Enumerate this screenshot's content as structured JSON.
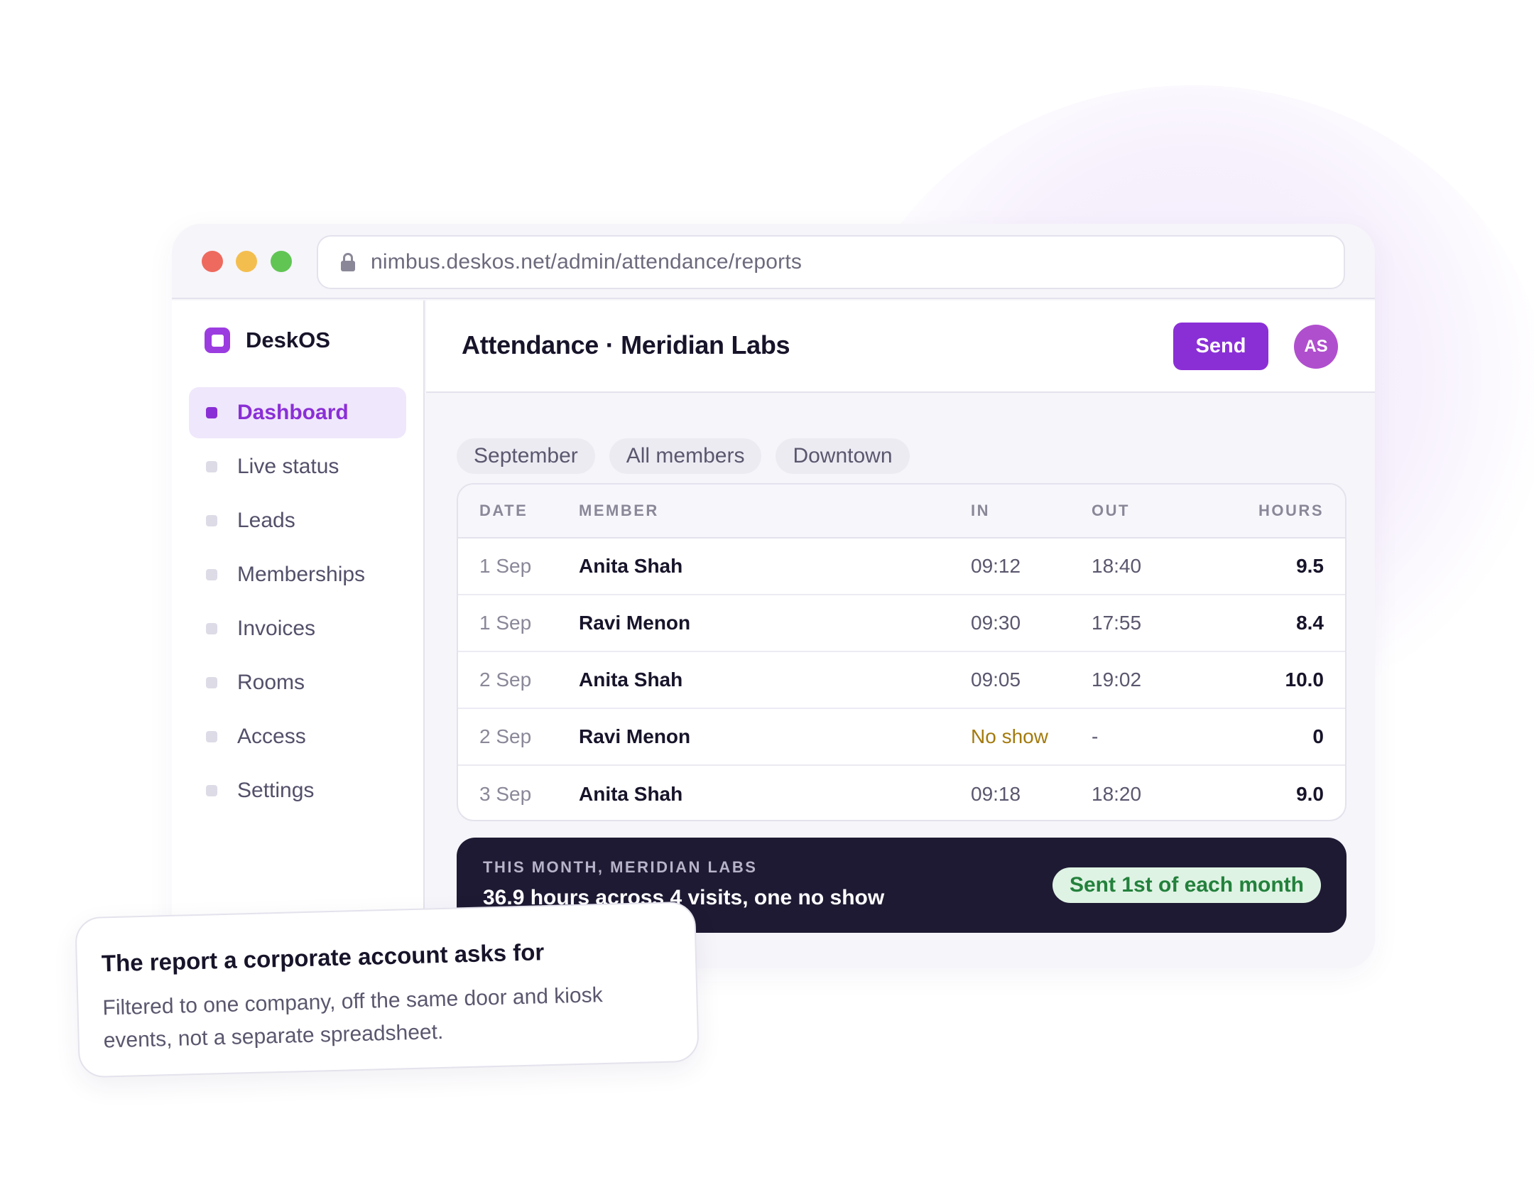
{
  "browser": {
    "url": "nimbus.deskos.net/admin/attendance/reports"
  },
  "brand": {
    "name": "DeskOS"
  },
  "sidebar": {
    "items": [
      {
        "label": "Dashboard",
        "active": true
      },
      {
        "label": "Live status",
        "active": false
      },
      {
        "label": "Leads",
        "active": false
      },
      {
        "label": "Memberships",
        "active": false
      },
      {
        "label": "Invoices",
        "active": false
      },
      {
        "label": "Rooms",
        "active": false
      },
      {
        "label": "Access",
        "active": false
      },
      {
        "label": "Settings",
        "active": false
      }
    ]
  },
  "header": {
    "title": "Attendance · Meridian Labs",
    "send_label": "Send",
    "avatar_initials": "AS"
  },
  "filters": [
    "September",
    "All members",
    "Downtown"
  ],
  "table": {
    "columns": {
      "date": "DATE",
      "member": "MEMBER",
      "in": "IN",
      "out": "OUT",
      "hours": "HOURS"
    },
    "rows": [
      {
        "date": "1 Sep",
        "member": "Anita Shah",
        "in": "09:12",
        "out": "18:40",
        "hours": "9.5"
      },
      {
        "date": "1 Sep",
        "member": "Ravi Menon",
        "in": "09:30",
        "out": "17:55",
        "hours": "8.4"
      },
      {
        "date": "2 Sep",
        "member": "Anita Shah",
        "in": "09:05",
        "out": "19:02",
        "hours": "10.0"
      },
      {
        "date": "2 Sep",
        "member": "Ravi Menon",
        "in": "No show",
        "out": "-",
        "hours": "0"
      },
      {
        "date": "3 Sep",
        "member": "Anita Shah",
        "in": "09:18",
        "out": "18:20",
        "hours": "9.0"
      }
    ]
  },
  "summary": {
    "label": "THIS MONTH, MERIDIAN LABS",
    "text": "36.9 hours across 4 visits, one no show",
    "badge": "Sent 1st of each month"
  },
  "callout": {
    "title": "The report a corporate account asks for",
    "body": "Filtered to one company, off the same door and kiosk events, not a separate spreadsheet."
  },
  "colors": {
    "accent": "#8a2fd6",
    "summary_bg": "#1f1a33",
    "badge_green": "#23813c",
    "no_show": "#a37a0d"
  }
}
